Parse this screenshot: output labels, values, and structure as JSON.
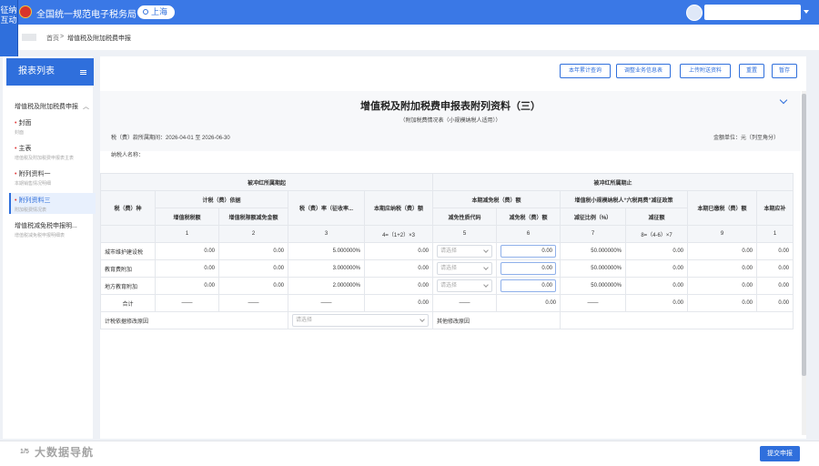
{
  "header": {
    "site_title": "全国统一规范电子税务局",
    "region": "上海",
    "side_tag": "征纳互动"
  },
  "breadcrumb": [
    "首页",
    "增值税及附加税费申报"
  ],
  "sidebar": {
    "header": "报表列表",
    "group": "增值税及附加税费申报",
    "items": [
      {
        "title": "封面",
        "sub": "封面",
        "required": true,
        "active": false
      },
      {
        "title": "主表",
        "sub": "增值税及附加税费申报表主表",
        "required": true,
        "active": false
      },
      {
        "title": "附列资料一",
        "sub": "本期销售情况明细",
        "required": true,
        "active": false
      },
      {
        "title": "附列资料三",
        "sub": "附加税费情况表",
        "required": true,
        "active": true
      },
      {
        "title": "增值税减免税申报明...",
        "sub": "增值税减免税申报明细表",
        "required": false,
        "active": false
      }
    ]
  },
  "toolbar": {
    "buttons": [
      "本年累计查询",
      "调整业务信息表",
      "上传附送资料",
      "重置",
      "暂存"
    ]
  },
  "form": {
    "title": "增值税及附加税费申报表附列资料（三）",
    "subtitle": "（附加税费情况表（小规模纳税人适用））",
    "period_label": "税（费）款所属期间：",
    "period_value": "2026-04-01 至 2026-06-30",
    "unit": "金额单位：元（列至角分）",
    "taxpayer_label": "纳税人名称："
  },
  "table": {
    "section_left": "被冲红所属期起",
    "section_right": "被冲红所属期止",
    "headers": {
      "tax_type": "税（费）种",
      "basis_group": "计税（费）依据",
      "basis_vat": "增值税税额",
      "basis_deduct": "增值税限额减免金额",
      "rate": "税（费）率（征收率...",
      "payable": "本期应纳税（费）额",
      "relief_group": "本期减免税（费）额",
      "relief_code": "减免性质代码",
      "relief_amount": "减免税（费）额",
      "small_group": "增值税小规模纳税人“六税两费”减征政策",
      "small_ratio": "减征比例（%）",
      "small_amount": "减征额",
      "paid": "本期已缴税（费）额",
      "more": "本期应补"
    },
    "col_numbers": [
      "1",
      "2",
      "3",
      "4=（1+2）×3",
      "5",
      "6",
      "7",
      "8=（4-6）×7",
      "9",
      "1"
    ],
    "rows": [
      {
        "name": "城市维护建设税",
        "c1": "0.00",
        "c2": "0.00",
        "c3": "5.000000%",
        "c4": "0.00",
        "c5": "请选择",
        "c6": "0.00",
        "c7": "50.000000%",
        "c8": "0.00",
        "c9": "0.00",
        "c10": "0.00"
      },
      {
        "name": "教育费附加",
        "c1": "0.00",
        "c2": "0.00",
        "c3": "3.000000%",
        "c4": "0.00",
        "c5": "请选择",
        "c6": "0.00",
        "c7": "50.000000%",
        "c8": "0.00",
        "c9": "0.00",
        "c10": "0.00"
      },
      {
        "name": "地方教育附加",
        "c1": "0.00",
        "c2": "0.00",
        "c3": "2.000000%",
        "c4": "0.00",
        "c5": "请选择",
        "c6": "0.00",
        "c7": "50.000000%",
        "c8": "0.00",
        "c9": "0.00",
        "c10": "0.00"
      }
    ],
    "total": {
      "name": "合计",
      "dash": "——",
      "c4": "0.00",
      "c6": "0.00",
      "c8": "0.00",
      "c9": "0.00",
      "c10": "0.00"
    },
    "basis_reason_label": "计税依据修改原因",
    "basis_reason_placeholder": "请选择",
    "other_reason_label": "其他修改原因"
  },
  "footer": {
    "progress": "1/5",
    "watermark": "大数据导航",
    "submit": "提交申报"
  },
  "colors": {
    "accent": "#2f6fdc",
    "topbar": "#3a78e6",
    "required": "#e03b3b"
  }
}
